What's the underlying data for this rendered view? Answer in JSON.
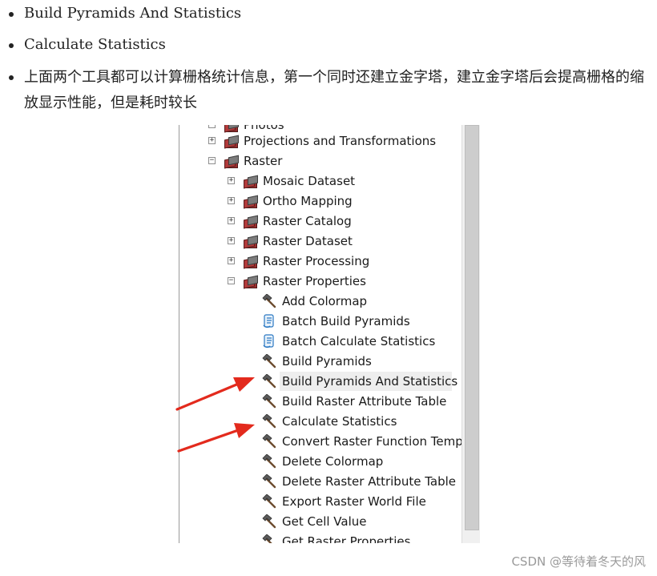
{
  "bullets": [
    "Build Pyramids And Statistics",
    "Calculate Statistics",
    "上面两个工具都可以计算栅格统计信息，第一个同时还建立金字塔，建立金字塔后会提高栅格的缩放显示性能，但是耗时较长"
  ],
  "tree": {
    "partial_top": "Photos",
    "projections": "Projections and Transformations",
    "raster": "Raster",
    "raster_children": [
      "Mosaic Dataset",
      "Ortho Mapping",
      "Raster Catalog",
      "Raster Dataset",
      "Raster Processing",
      "Raster Properties"
    ],
    "raster_properties_tools": [
      {
        "label": "Add Colormap",
        "icon": "hammer-icon"
      },
      {
        "label": "Batch Build Pyramids",
        "icon": "script-icon"
      },
      {
        "label": "Batch Calculate Statistics",
        "icon": "script-icon"
      },
      {
        "label": "Build Pyramids",
        "icon": "hammer-icon"
      },
      {
        "label": "Build Pyramids And Statistics",
        "icon": "hammer-icon"
      },
      {
        "label": "Build Raster Attribute Table",
        "icon": "hammer-icon"
      },
      {
        "label": "Calculate Statistics",
        "icon": "hammer-icon"
      },
      {
        "label": "Convert Raster Function Templ",
        "icon": "hammer-icon"
      },
      {
        "label": "Delete Colormap",
        "icon": "hammer-icon"
      },
      {
        "label": "Delete Raster Attribute Table",
        "icon": "hammer-icon"
      },
      {
        "label": "Export Raster World File",
        "icon": "hammer-icon"
      },
      {
        "label": "Get Cell Value",
        "icon": "hammer-icon"
      },
      {
        "label": "Get Raster Properties",
        "icon": "hammer-icon"
      }
    ],
    "highlighted": "Build Pyramids And Statistics"
  },
  "colors": {
    "arrow": "#e32a1d",
    "highlight": "#eeeeee",
    "text": "#1a1a1a"
  },
  "watermark": "CSDN @等待着冬天的风"
}
